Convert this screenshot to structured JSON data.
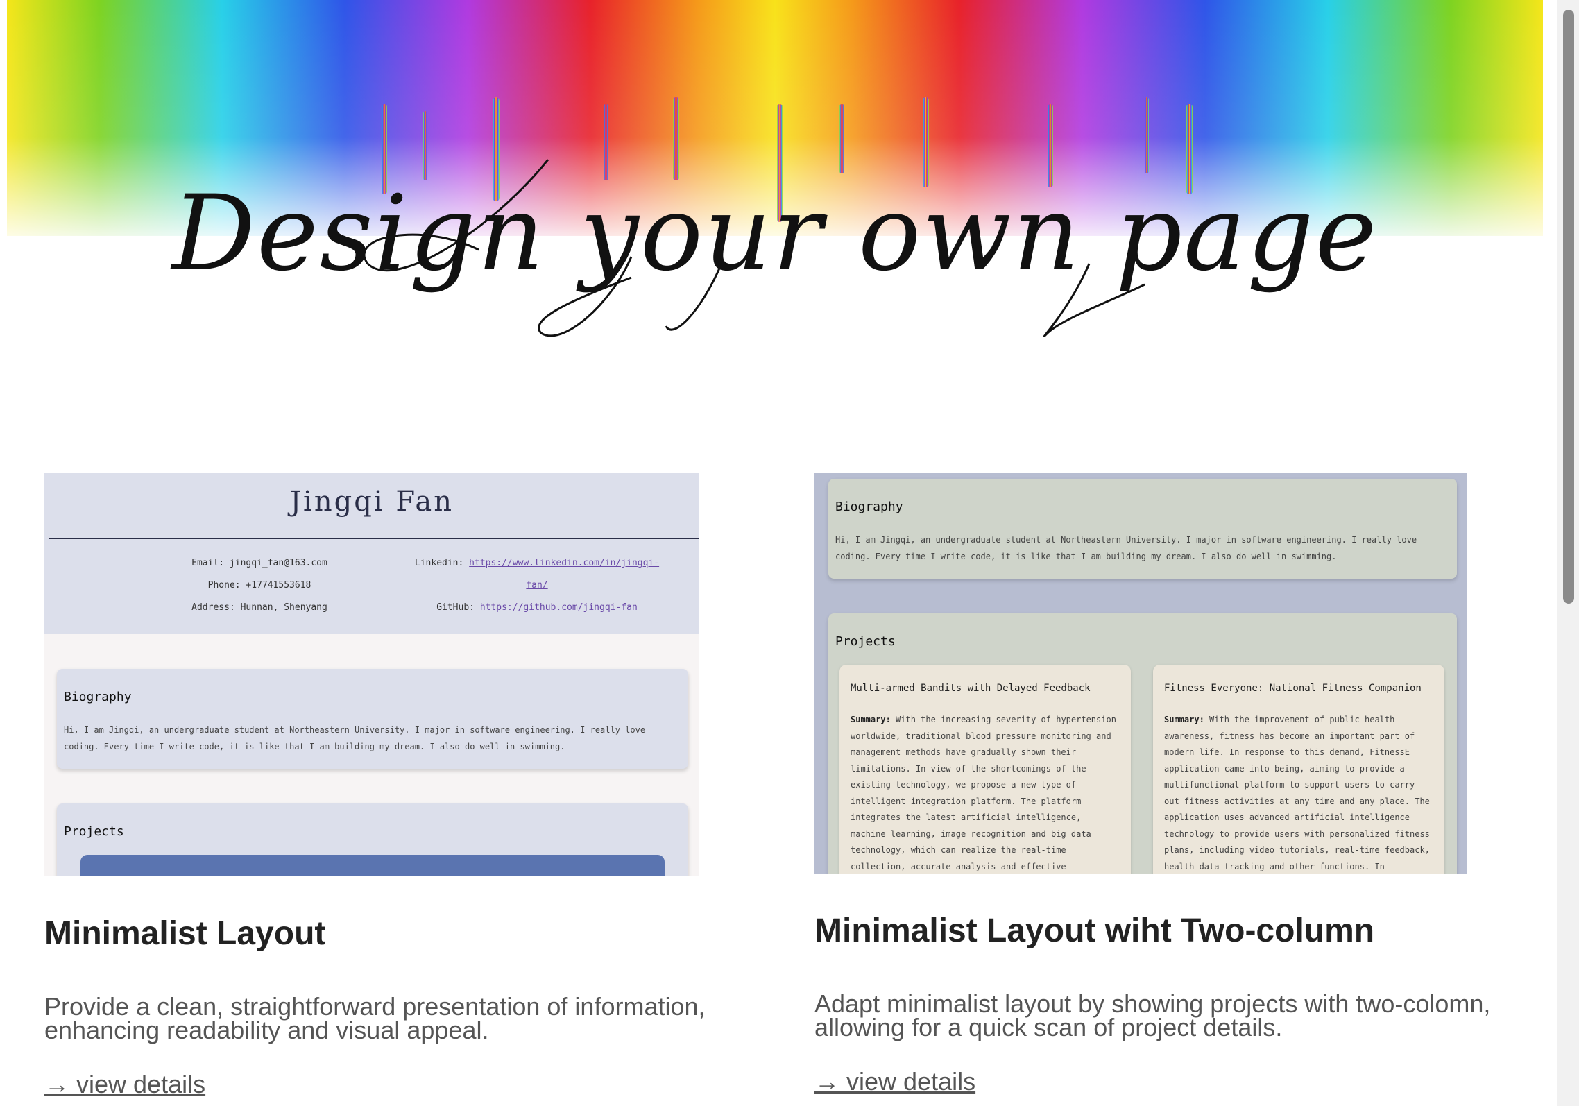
{
  "banner": {
    "title": "Design your own page"
  },
  "cards": [
    {
      "title": "Minimalist Layout",
      "description": "Provide a clean, straightforward presentation of information, enhancing readability and visual appeal.",
      "link": "→ view details",
      "preview": {
        "name": "Jingqi Fan",
        "email": "Email: jingqi_fan@163.com",
        "phone": "Phone: +17741553618",
        "address": "Address: Hunnan, Shenyang",
        "linkedin_label": "Linkedin:",
        "linkedin_url": "https://www.linkedin.com/in/jingqi-fan/",
        "github_label": "GitHub:",
        "github_url": "https://github.com/jingqi-fan",
        "bio_title": "Biography",
        "bio_text_1": "Hi, I am Jingqi, an undergraduate student at Northeastern University. I major in software engineering. I really love",
        "bio_text_2": "coding. Every time I write code, it is like that I am building my dream. I also do well in swimming.",
        "projects_title": "Projects"
      }
    },
    {
      "title": "Minimalist Layout wiht Two-column",
      "description": "Adapt minimalist layout by showing projects with two-colomn, allowing for a quick scan of project details.",
      "link": "→ view details",
      "preview": {
        "bio_title": "Biography",
        "bio_text_1": "Hi, I am Jingqi, an undergraduate student at Northeastern University. I major in software engineering. I really love",
        "bio_text_2": "coding. Every time I write code, it is like that I am building my dream. I also do well in swimming.",
        "projects_title": "Projects",
        "projects": [
          {
            "title": "Multi-armed Bandits with Delayed Feedback",
            "summary_label": "Summary:",
            "summary": "With the increasing severity of hypertension worldwide, traditional blood pressure monitoring and management methods have gradually shown their limitations. In view of the shortcomings of the existing technology, we propose a new type of intelligent integration platform. The platform integrates the latest artificial intelligence, machine learning, image recognition and big data technology, which can realize the real-time collection, accurate analysis and effective"
          },
          {
            "title": "Fitness Everyone: National Fitness Companion",
            "summary_label": "Summary:",
            "summary": "With the improvement of public health awareness, fitness has become an important part of modern life. In response to this demand, FitnessE application came into being, aiming to provide a multifunctional platform to support users to carry out fitness activities at any time and any place. The application uses advanced artificial intelligence technology to provide users with personalized fitness plans, including video tutorials, real-time feedback, health data tracking and other functions. In"
          }
        ]
      }
    }
  ],
  "colors": {
    "header_bg": "#dcdfeb",
    "card_green": "#cfd4ca",
    "project_cream": "#ece6da",
    "accent_blue": "#5a74b0"
  }
}
